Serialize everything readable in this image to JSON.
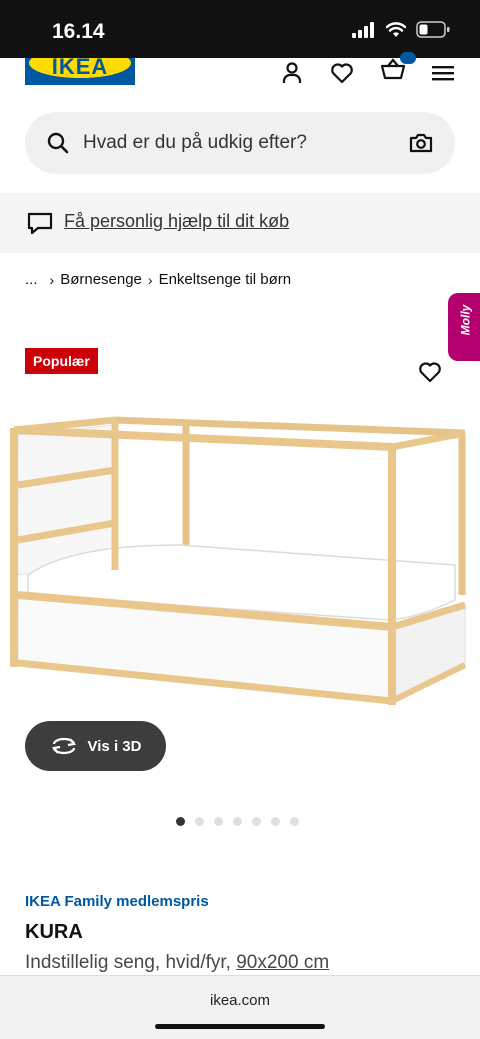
{
  "status_bar": {
    "time": "16.14"
  },
  "header": {
    "logo_text": "IKEA"
  },
  "search": {
    "placeholder": "Hvad er du på udkig efter?"
  },
  "help_banner": {
    "text": "Få personlig hjælp til dit køb"
  },
  "breadcrumb": {
    "items": [
      "...",
      "Børnesenge",
      "Enkeltsenge til børn"
    ]
  },
  "molly": {
    "label": "Molly"
  },
  "product": {
    "badge": "Populær",
    "view_3d_label": "Vis i 3D",
    "gallery": {
      "count": 7,
      "active_index": 0
    },
    "family_price_label": "IKEA Family medlemspris",
    "name": "KURA",
    "description": "Indstillelig seng, hvid/fyr,",
    "size": "90x200 cm"
  },
  "browser": {
    "url": "ikea.com"
  },
  "colors": {
    "ikea_blue": "#0058a3",
    "ikea_yellow": "#ffdb00",
    "badge_red": "#cc0008",
    "molly_magenta": "#b4006e"
  },
  "icons": [
    "user-icon",
    "heart-icon",
    "basket-icon",
    "menu-icon",
    "search-icon",
    "camera-icon",
    "chat-icon",
    "rotate-3d-icon"
  ]
}
